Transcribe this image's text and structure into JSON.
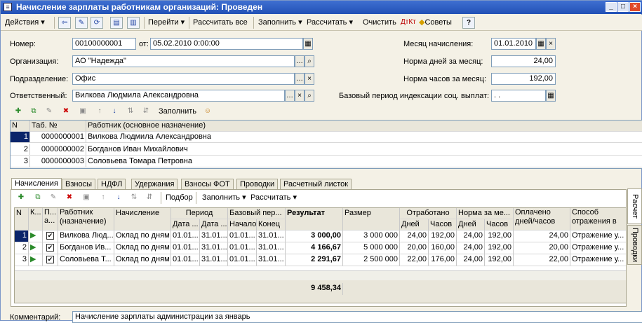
{
  "window": {
    "title": "Начисление зарплаты работникам организаций: Проведен",
    "icon": "document-icon",
    "controls": [
      "_",
      "□",
      "×"
    ]
  },
  "toolbar": {
    "actions": "Действия",
    "goto": "Перейти",
    "recalc_all": "Рассчитать все",
    "fill": "Заполнить",
    "calculate": "Рассчитать",
    "clear": "Очистить",
    "tips": "Советы",
    "help": "?"
  },
  "header": {
    "number_label": "Номер:",
    "number": "00100000001",
    "from_label": "от:",
    "date": "05.02.2010  0:00:00",
    "org_label": "Организация:",
    "org": "АО \"Надежда\"",
    "dept_label": "Подразделение:",
    "dept": "Офис",
    "resp_label": "Ответственный:",
    "resp": "Вилкова Людмила Александровна",
    "month_label": "Месяц начисления:",
    "month": "01.01.2010",
    "days_label": "Норма дней за месяц:",
    "days": "24,00",
    "hours_label": "Норма часов за месяц:",
    "hours": "192,00",
    "base_label": "Базовый период индексации соц. выплат:",
    "base": " .  ."
  },
  "emp_toolbar": {
    "fill": "Заполнить"
  },
  "employees": {
    "headers": {
      "n": "N",
      "tab": "Таб. №",
      "worker": "Работник (основное назначение)"
    },
    "rows": [
      {
        "n": "1",
        "tab": "0000000001",
        "name": "Вилкова Людмила Александровна"
      },
      {
        "n": "2",
        "tab": "0000000002",
        "name": "Богданов Иван Михайлович"
      },
      {
        "n": "3",
        "tab": "0000000003",
        "name": "Соловьева Томара Петровна"
      }
    ]
  },
  "tabs": [
    "Начисления",
    "Взносы",
    "НДФЛ",
    "Удержания",
    "Взносы ФОТ",
    "Проводки",
    "Расчетный листок"
  ],
  "side_tabs": [
    "Расчет",
    "Проводки"
  ],
  "accr_toolbar": {
    "pick": "Подбор",
    "fill": "Заполнить",
    "calculate": "Рассчитать"
  },
  "accruals": {
    "headers": {
      "n": "N",
      "k": "К...",
      "p": "П... а...",
      "worker": "Работник (назначение)",
      "accrual": "Начисление",
      "period": "Период",
      "p_from": "Дата ...",
      "p_to": "Дата ...",
      "base": "Базовый пер...",
      "b_start": "Начало",
      "b_end": "Конец",
      "result": "Результат",
      "size": "Размер",
      "worked": "Отработано",
      "w_days": "Дней",
      "w_hours": "Часов",
      "norm": "Норма за ме...",
      "n_days": "Дней",
      "n_hours": "Часов",
      "paid": "Оплачено дней/часов",
      "method": "Способ отражения в"
    },
    "rows": [
      {
        "n": "1",
        "worker": "Вилкова Люд...",
        "accrual": "Оклад по дням",
        "from": "01.01...",
        "to": "31.01...",
        "bstart": "01.01...",
        "bend": "31.01...",
        "result": "3 000,00",
        "size": "3 000 000",
        "wd": "24,00",
        "wh": "192,00",
        "nd": "24,00",
        "nh": "192,00",
        "paid": "24,00",
        "method": "Отражение у..."
      },
      {
        "n": "2",
        "worker": "Богданов Ив...",
        "accrual": "Оклад по дням",
        "from": "01.01...",
        "to": "31.01...",
        "bstart": "01.01...",
        "bend": "31.01...",
        "result": "4 166,67",
        "size": "5 000 000",
        "wd": "20,00",
        "wh": "160,00",
        "nd": "24,00",
        "nh": "192,00",
        "paid": "20,00",
        "method": "Отражение у..."
      },
      {
        "n": "3",
        "worker": "Соловьева Т...",
        "accrual": "Оклад по дням",
        "from": "01.01...",
        "to": "31.01...",
        "bstart": "01.01...",
        "bend": "31.01...",
        "result": "2 291,67",
        "size": "2 500 000",
        "wd": "22,00",
        "wh": "176,00",
        "nd": "24,00",
        "nh": "192,00",
        "paid": "22,00",
        "method": "Отражение у..."
      }
    ],
    "total": "9 458,34"
  },
  "comment": {
    "label": "Комментарий:",
    "value": "Начисление зарплаты администрации за январь"
  }
}
